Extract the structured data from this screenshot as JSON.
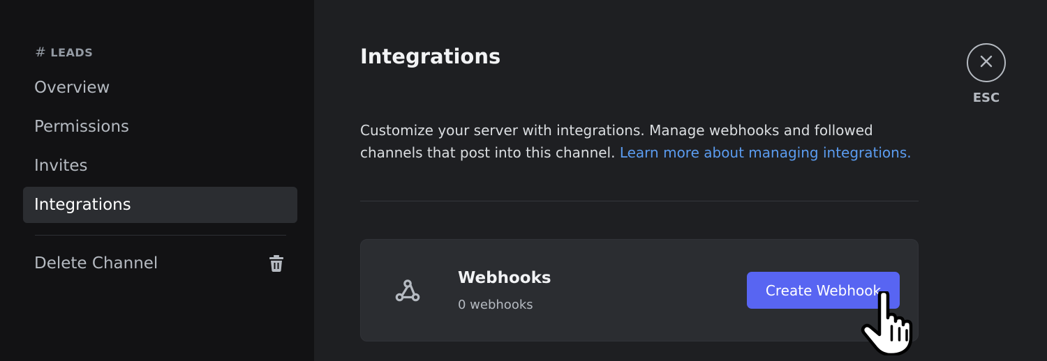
{
  "sidebar": {
    "channel_hash": "#",
    "channel_name": "LEADS",
    "items": [
      {
        "label": "Overview"
      },
      {
        "label": "Permissions"
      },
      {
        "label": "Invites"
      },
      {
        "label": "Integrations",
        "active": true
      }
    ],
    "delete_label": "Delete Channel",
    "delete_icon": "trash-icon"
  },
  "main": {
    "title": "Integrations",
    "description": "Customize your server with integrations. Manage webhooks and followed channels that post into this channel.",
    "learn_more_link": "Learn more about managing integrations.",
    "webhooks_card": {
      "icon": "webhook-icon",
      "title": "Webhooks",
      "count_text": "0 webhooks",
      "button_label": "Create Webhook"
    }
  },
  "close": {
    "icon": "close-icon",
    "label": "ESC"
  },
  "colors": {
    "accent": "#5865f2",
    "link": "#5b9cf0",
    "sidebar_bg": "#121214",
    "main_bg": "#1e1f22"
  }
}
